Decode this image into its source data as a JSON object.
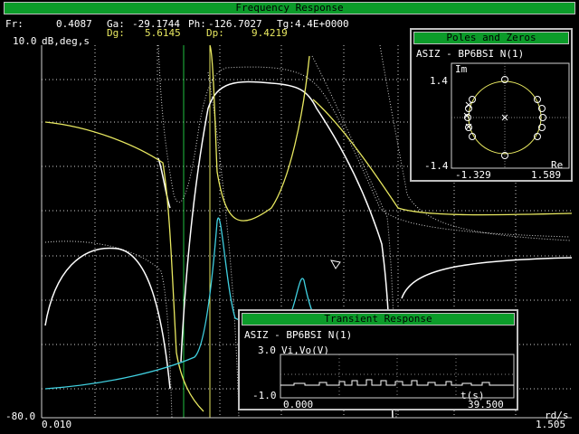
{
  "main_window": {
    "title": "Frequency Response",
    "readout": {
      "fr_label": "Fr:",
      "fr_value": "0.4087",
      "ga_label": "Ga:",
      "ga_value": "-29.1744",
      "ph_label": "Ph:",
      "ph_value": "-126.7027",
      "tg_label": "Tg:",
      "tg_value": "4.4E+0000",
      "dg_label": "Dg:",
      "dg_value": "5.6145",
      "dp_label": "Dp:",
      "dp_value": "9.4219"
    },
    "y_max_label": "10.0",
    "y_units": "dB,deg,s",
    "y_min_label": "-80.0",
    "x_min_label": "0.010",
    "x_max_label": "1.505",
    "x_units": "rd/s"
  },
  "poles_window": {
    "title": "Poles and Zeros",
    "filter_name": "ASIZ - BP6BSI N(1)",
    "im_max": "1.4",
    "im_label": "Im",
    "im_min": "-1.4",
    "re_label": "Re",
    "re_min": "-1.329",
    "re_max": "1.589"
  },
  "transient_window": {
    "title": "Transient Response",
    "filter_name": "ASIZ - BP6BSI N(1)",
    "y_max": "3.0",
    "y_label": "Vi,Vo(V)",
    "y_min": "-1.0",
    "t_label": "t(s)",
    "t_min": "0.000",
    "t_max": "39.500"
  },
  "colors": {
    "title_bar": "#0c9c2a",
    "gain_curve": "#ffffff",
    "phase_curve": "#e8e860",
    "delay_curve": "#40d0e0",
    "cursor_line": "#20c040"
  }
}
